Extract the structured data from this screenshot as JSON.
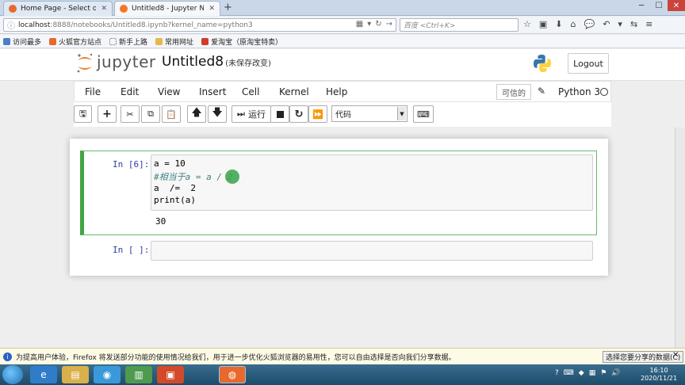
{
  "browser": {
    "tabs": [
      {
        "label": "Home Page - Select or c...",
        "active": false
      },
      {
        "label": "Untitled8 - Jupyter Note...",
        "active": true
      }
    ],
    "url_host": "localhost",
    "url_rest": ":8888/notebooks/Untitled8.ipynb?kernel_name=python3",
    "search_placeholder": "百度 <Ctrl+K>",
    "bookmarks": [
      "访问最多",
      "火狐官方站点",
      "新手上路",
      "常用网址",
      "爱淘宝（原淘宝特卖）"
    ]
  },
  "jupyter": {
    "logo_text": "jupyter",
    "notebook_title": "Untitled8",
    "save_status": "(未保存改变)",
    "logout_label": "Logout",
    "menus": [
      "File",
      "Edit",
      "View",
      "Insert",
      "Cell",
      "Kernel",
      "Help"
    ],
    "trusted_label": "可信的",
    "kernel_name": "Python 3",
    "toolbar": {
      "run_label": "运行",
      "cell_type": "代码"
    },
    "cells": [
      {
        "prompt": "In [6]:",
        "code_lines": [
          "a = 10",
          "#相当于a = a / 2",
          "a  /=  2",
          "print(a)"
        ],
        "output": "30"
      },
      {
        "prompt": "In [ ]:",
        "code_lines": [],
        "output": ""
      }
    ]
  },
  "notification": {
    "text": "为提高用户体验，Firefox 将发送部分功能的使用情况给我们，用于进一步优化火狐浏览器的易用性，您可以自由选择是否向我们分享数据。",
    "button": "选择您要分享的数据(C)"
  },
  "taskbar": {
    "time": "16:10",
    "date": "2020/11/21"
  }
}
